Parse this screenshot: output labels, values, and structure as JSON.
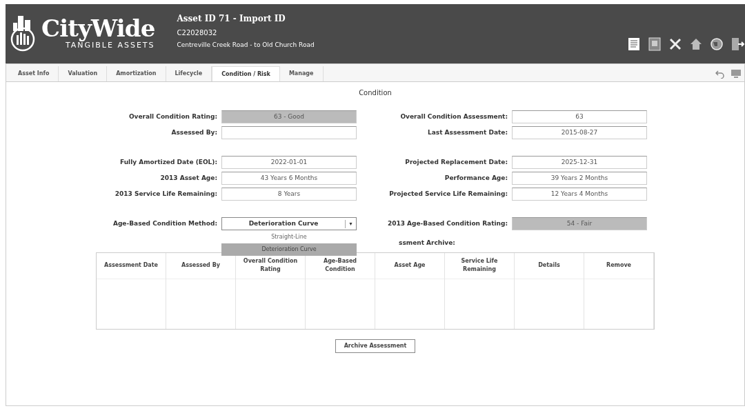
{
  "header": {
    "logo": {
      "name": "CityWide",
      "tagline": "TANGIBLE ASSETS"
    },
    "title": "Asset ID 71 - Import ID",
    "asset_code": "C22028032",
    "location": "Centreville Creek Road - to Old Church Road"
  },
  "tabs": [
    {
      "label": "Asset Info",
      "selected": false
    },
    {
      "label": "Valuation",
      "selected": false
    },
    {
      "label": "Amortization",
      "selected": false
    },
    {
      "label": "Lifecycle",
      "selected": false
    },
    {
      "label": "Condition / Risk",
      "selected": true
    },
    {
      "label": "Manage",
      "selected": false
    }
  ],
  "section_title": "Condition",
  "field_groups": [
    {
      "left": [
        {
          "label": "Overall Condition Rating:",
          "value": "63 - Good",
          "shaded": true
        },
        {
          "label": "Assessed By:",
          "shaded": false
        }
      ],
      "right": [
        {
          "label": "Overall Condition Assessment:",
          "value": "63",
          "shaded": false
        },
        {
          "label": "Last Assessment Date:",
          "value": "2015-08-27",
          "shaded": false
        }
      ]
    },
    {
      "left": [
        {
          "label": "Fully Amortized Date (EOL):",
          "value": "2022-01-01",
          "shaded": false
        },
        {
          "label": "2013 Asset Age:",
          "value": "43 Years 6 Months",
          "shaded": false
        },
        {
          "label": "2013 Service Life Remaining:",
          "value": "8 Years",
          "shaded": false
        }
      ],
      "right": [
        {
          "label": "Projected Replacement Date:",
          "value": "2025-12-31",
          "shaded": false
        },
        {
          "label": "Performance Age:",
          "value": "39 Years 2 Months",
          "shaded": false
        },
        {
          "label": "Projected Service Life Remaining:",
          "value": "12 Years 4 Months",
          "shaded": false
        }
      ]
    }
  ],
  "method": {
    "label": "Age-Based Condition Method:",
    "value": "Deterioration Curve",
    "caret": "▾",
    "expanded": true,
    "options": [
      {
        "label": "Straight-Line",
        "selected": false
      },
      {
        "label": "Deterioration Curve",
        "selected": true
      }
    ]
  },
  "age_rating": {
    "label": "2013 Age-Based Condition Rating:",
    "value": "54 - Fair"
  },
  "archive_title": "ssment Archive:",
  "table": {
    "columns": [
      "Assessment Date",
      "Assessed By",
      "Overall Condition Rating",
      "Age-Based Condition",
      "Asset Age",
      "Service Life Remaining",
      "Details",
      "Remove"
    ]
  },
  "archive_button": "Archive Assessment"
}
